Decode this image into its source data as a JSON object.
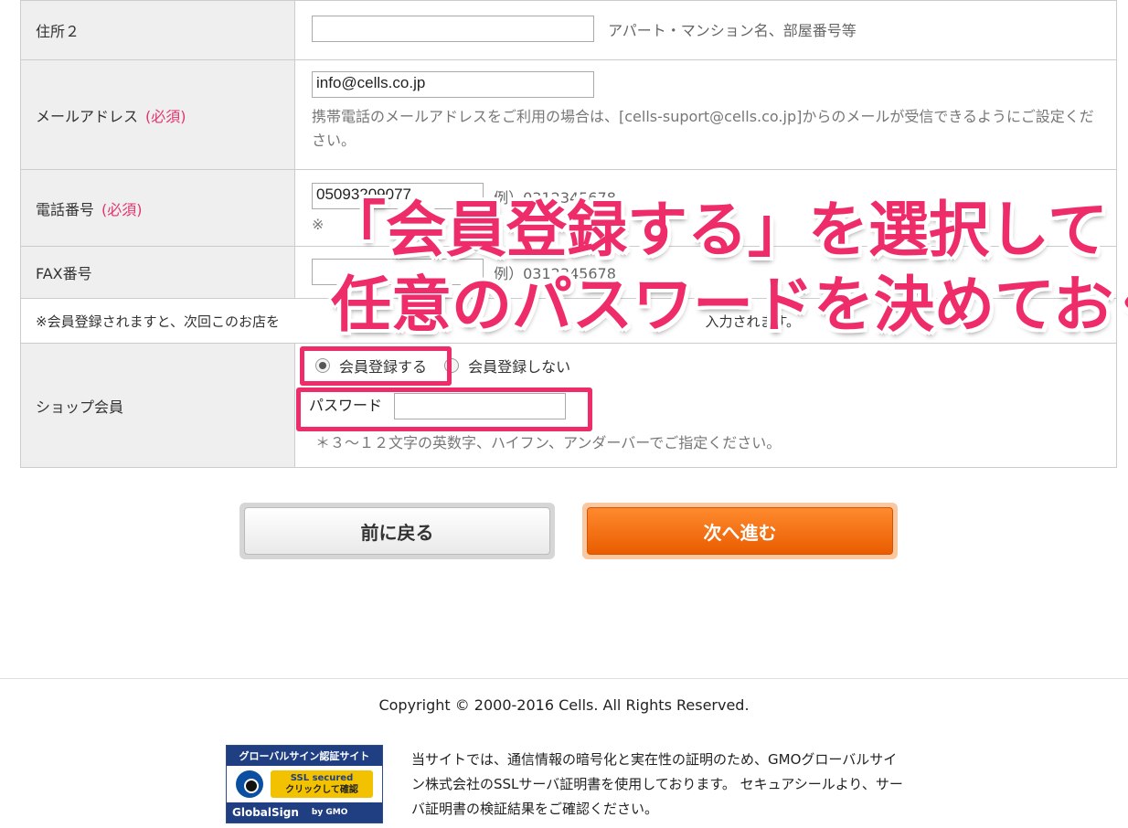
{
  "form": {
    "address2": {
      "label": "住所２",
      "value": "",
      "hint": "アパート・マンション名、部屋番号等"
    },
    "email": {
      "label": "メールアドレス",
      "required": "(必須)",
      "value": "info@cells.co.jp",
      "hint": "携帯電話のメールアドレスをご利用の場合は、[cells-suport@cells.co.jp]からのメールが受信できるようにご設定ください。"
    },
    "phone": {
      "label": "電話番号",
      "required": "(必須)",
      "value": "05093209077",
      "example": "例）0312345678",
      "note": "※"
    },
    "fax": {
      "label": "FAX番号",
      "value": "",
      "example": "例）0312345678"
    },
    "member_notice": "※会員登録されますと、次回このお店を",
    "member_notice_tail": "入力されます。",
    "shop_member": {
      "label": "ショップ会員",
      "option_register": "会員登録する",
      "option_no_register": "会員登録しない",
      "selected": "会員登録する",
      "password_label": "パスワード",
      "password_value": "",
      "password_hint": "＊３～１２文字の英数字、ハイフン、アンダーバーでご指定ください。"
    }
  },
  "overlay": {
    "line1": "「会員登録する」を選択して",
    "line2": "任意のパスワードを決めておく",
    "color": "#ee2c6a"
  },
  "buttons": {
    "back": "前に戻る",
    "next": "次へ進む"
  },
  "footer": {
    "copyright": "Copyright © 2000-2016 Cells. All Rights Reserved.",
    "ssl_badge": {
      "top": "グローバルサイン認証サイト",
      "secured": "SSL secured",
      "click": "クリックして確認",
      "brand": "GlobalSign",
      "by": "by GMO"
    },
    "ssl_text": "当サイトでは、通信情報の暗号化と実在性の証明のため、GMOグローバルサイン株式会社のSSLサーバ証明書を使用しております。 セキュアシールより、サーバ証明書の検証結果をご確認ください。"
  }
}
